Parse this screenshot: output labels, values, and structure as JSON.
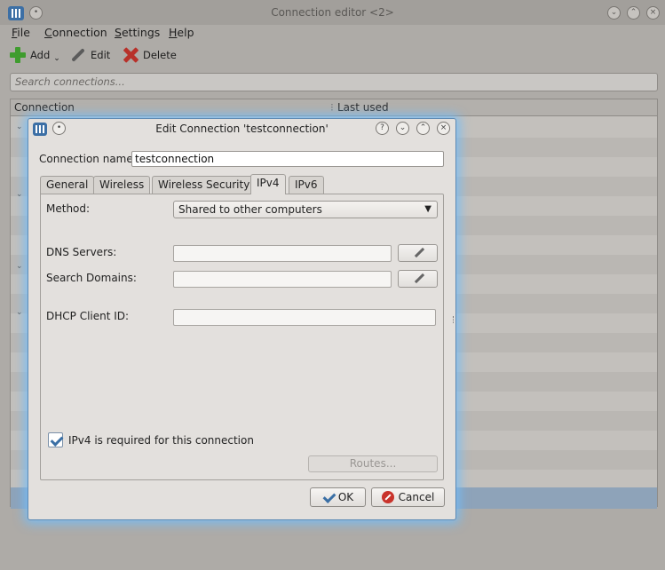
{
  "main_window": {
    "title": "Connection editor <2>",
    "menu": [
      "File",
      "Connection",
      "Settings",
      "Help"
    ],
    "toolbar": {
      "add": "Add",
      "edit": "Edit",
      "delete": "Delete"
    },
    "search_placeholder": "Search connections...",
    "columns": {
      "connection": "Connection",
      "last_used": "Last used"
    }
  },
  "dialog": {
    "title": "Edit Connection 'testconnection'",
    "connection_name_label": "Connection name:",
    "connection_name_value": "testconnection",
    "tabs": [
      "General",
      "Wireless",
      "Wireless Security",
      "IPv4",
      "IPv6"
    ],
    "active_tab": "IPv4",
    "method_label": "Method:",
    "method_value": "Shared to other computers",
    "dns_label": "DNS Servers:",
    "search_domains_label": "Search Domains:",
    "dhcp_label": "DHCP Client ID:",
    "required_label": "IPv4 is required for this connection",
    "required_checked": true,
    "routes_button": "Routes...",
    "ok_button": "OK",
    "cancel_button": "Cancel"
  }
}
